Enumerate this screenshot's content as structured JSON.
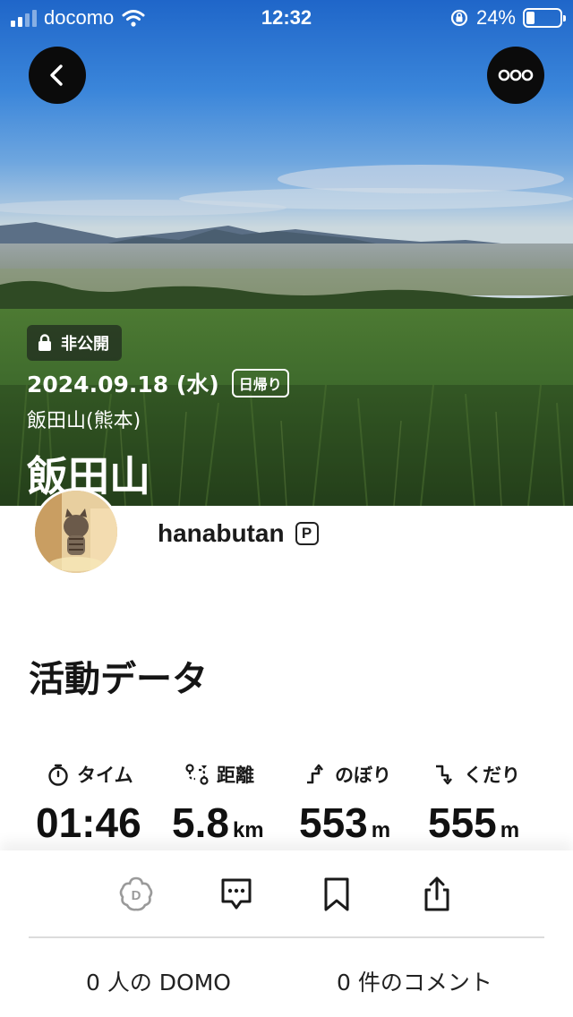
{
  "status_bar": {
    "carrier": "docomo",
    "time": "12:32",
    "battery_percent": "24%",
    "battery_level": 0.24,
    "icons": [
      "signal-icon",
      "wifi-icon",
      "orientation-lock-icon",
      "battery-icon"
    ]
  },
  "nav": {
    "back_icon": "chevron-left-icon",
    "more_icon": "more-dots-icon"
  },
  "activity": {
    "visibility": "非公開",
    "date": "2024.09.18 (水)",
    "trip_type": "日帰り",
    "location": "飯田山(熊本)",
    "title": "飯田山"
  },
  "user": {
    "name": "hanabutan",
    "badge": "P"
  },
  "stats_section": {
    "title": "活動データ",
    "items": [
      {
        "label": "タイム",
        "icon": "stopwatch-icon",
        "value": "01:46",
        "unit": ""
      },
      {
        "label": "距離",
        "icon": "route-icon",
        "value": "5.8",
        "unit": "km"
      },
      {
        "label": "のぼり",
        "icon": "ascent-icon",
        "value": "553",
        "unit": "m"
      },
      {
        "label": "くだり",
        "icon": "descent-icon",
        "value": "555",
        "unit": "m"
      }
    ]
  },
  "actions": {
    "icons": [
      "domo-icon",
      "comment-icon",
      "bookmark-icon",
      "share-icon"
    ],
    "domo_count": "0 人の DOMO",
    "comment_count": "0 件のコメント"
  },
  "colors": {
    "hero_sky": "#3b86da",
    "button_bg": "#0b0b0b",
    "domo_icon": "#9a9a9a"
  }
}
